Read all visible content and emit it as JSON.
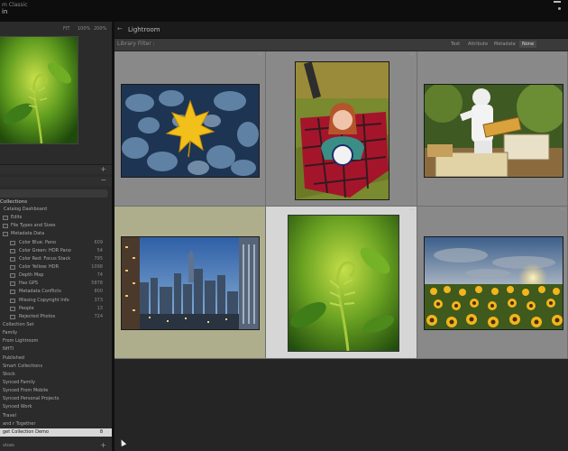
{
  "app": {
    "name_line1": "m Classic",
    "name_line2": "in"
  },
  "navigator": {
    "zoom_options": [
      "FIT",
      "100%",
      "200%"
    ]
  },
  "collections": {
    "header": "Collections",
    "items": [
      {
        "label": "Catalog Dashboard",
        "count": ""
      },
      {
        "label": "Edits",
        "count": ""
      },
      {
        "label": "File Types and Sizes",
        "count": ""
      },
      {
        "label": "Metadata Data",
        "count": ""
      },
      {
        "label": "Color Blue: Pano",
        "count": "609"
      },
      {
        "label": "Color Green: HDR Pano",
        "count": "54"
      },
      {
        "label": "Color Red: Focus Stack",
        "count": "795"
      },
      {
        "label": "Color Yellow: HDR",
        "count": "1098"
      },
      {
        "label": "Depth Map",
        "count": "74"
      },
      {
        "label": "Has GPS",
        "count": "5878"
      },
      {
        "label": "Metadata Conflicts",
        "count": "800"
      },
      {
        "label": "Missing Copyright Info",
        "count": "373"
      },
      {
        "label": "People",
        "count": "13"
      },
      {
        "label": "Rejected Photos",
        "count": "724"
      },
      {
        "label": "Collection Set",
        "count": ""
      },
      {
        "label": "Family",
        "count": ""
      },
      {
        "label": "From Lightroom",
        "count": ""
      },
      {
        "label": "NHTI",
        "count": ""
      },
      {
        "label": "Published",
        "count": ""
      },
      {
        "label": "Smart Collections",
        "count": ""
      },
      {
        "label": "Stock",
        "count": ""
      },
      {
        "label": "Synced Family",
        "count": ""
      },
      {
        "label": "Synced From Mobile",
        "count": ""
      },
      {
        "label": "Synced Personal Projects",
        "count": ""
      },
      {
        "label": "Synced Work",
        "count": ""
      },
      {
        "label": "Travel",
        "count": ""
      },
      {
        "label": "and r Together",
        "count": ""
      },
      {
        "label": "get Collection Demo",
        "count": "8"
      }
    ]
  },
  "publish_services": {
    "label": "vices"
  },
  "module": {
    "title": "Lightroom"
  },
  "filter": {
    "label": "Library Filter :",
    "options": [
      "Text",
      "Attribute",
      "Metadata",
      "None"
    ],
    "active": "None"
  }
}
